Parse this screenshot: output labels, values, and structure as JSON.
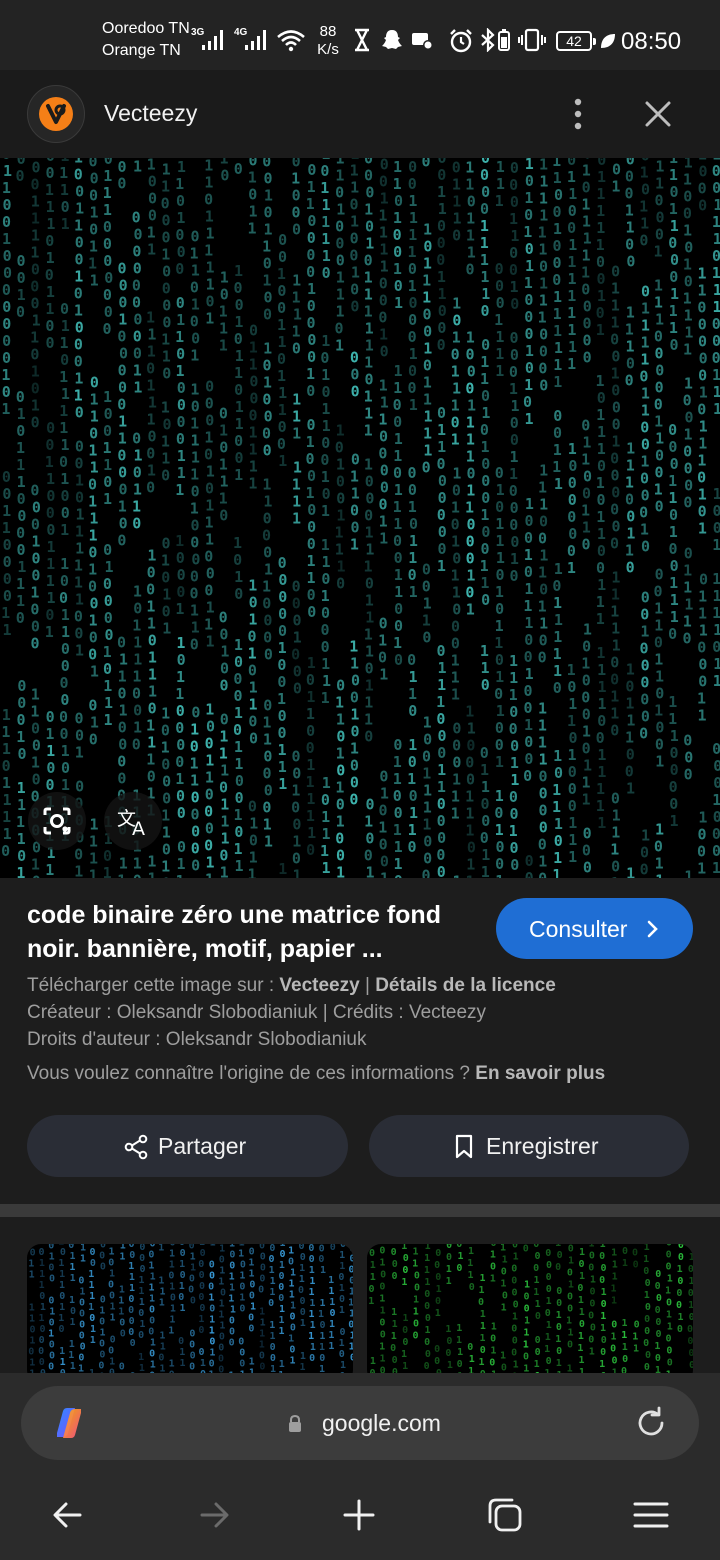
{
  "status_bar": {
    "carrier_1": "Ooredoo TN",
    "carrier_2": "Orange TN",
    "sig1_tag": "3G",
    "sig2_tag": "4G",
    "net_speed_value": "88",
    "net_speed_unit": "K/s",
    "battery": "42",
    "time": "08:50"
  },
  "site": {
    "name": "Vecteezy",
    "accent_color": "#f57f17"
  },
  "image": {
    "description_icon_left": "lens-icon",
    "description_icon_right": "translate-icon"
  },
  "result": {
    "title_line_1": "code binaire zéro une matrice fond",
    "title_line_2": "noir. bannière, motif, papier ...",
    "consult_label": "Consulter",
    "download_prefix": "Télécharger cette image sur : ",
    "download_site": "Vecteezy",
    "separator": " | ",
    "license_link": "Détails de la licence",
    "creator_line": "Créateur : Oleksandr Slobodianiuk | Crédits : Vecteezy",
    "rights_line": "Droits d'auteur : Oleksandr Slobodianiuk",
    "origin_prefix": "Vous voulez connaître l'origine de ces informations ? ",
    "learn_more": "En savoir plus",
    "share_label": "Partager",
    "save_label": "Enregistrer"
  },
  "browser": {
    "url": "google.com"
  },
  "colors": {
    "primary_button": "#1f6ed4",
    "matrix_teal": "#3fb6b0",
    "matrix_green": "#2ecc40"
  }
}
